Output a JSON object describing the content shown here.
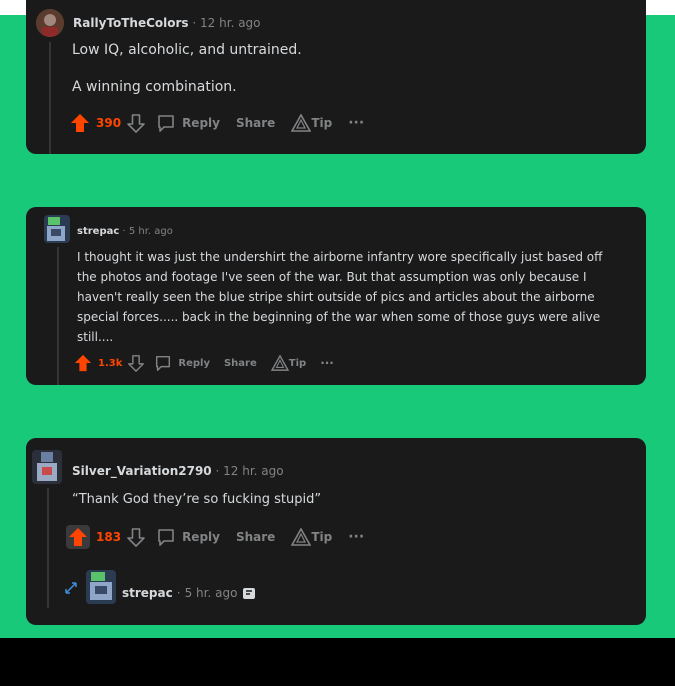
{
  "colors": {
    "background_green": "#18c97a",
    "card": "#1a1a1b",
    "upvote": "#ff4500",
    "text": "#d7dadc",
    "muted": "#818384"
  },
  "comments": [
    {
      "username": "RallyToTheColors",
      "separator": "·",
      "time": "12 hr. ago",
      "body": [
        "Low IQ, alcoholic, and untrained.",
        "A winning combination."
      ],
      "score": "390",
      "reply": "Reply",
      "share": "Share",
      "tip": "Tip",
      "more": "···"
    },
    {
      "username": "strepac",
      "separator": "·",
      "time": "5 hr. ago",
      "body": [
        "I thought it was just the undershirt the airborne infantry wore specifically just based off the photos and footage I've seen of the war. But that assumption was only because I haven't really seen the blue stripe shirt outside of pics and articles about the airborne special forces..... back in the beginning of the war when some of those guys were alive still...."
      ],
      "score": "1.3k",
      "reply": "Reply",
      "share": "Share",
      "tip": "Tip",
      "more": "···"
    },
    {
      "username": "Silver_Variation2790",
      "separator": "·",
      "time": "12 hr. ago",
      "body": [
        "“Thank God they’re so fucking stupid”"
      ],
      "score": "183",
      "reply": "Reply",
      "share": "Share",
      "tip": "Tip",
      "more": "···"
    }
  ],
  "collapsed_reply": {
    "username": "strepac",
    "separator": "·",
    "time": "5 hr. ago",
    "icon": "expand-icon",
    "badge_icon": "award-badge-icon"
  }
}
